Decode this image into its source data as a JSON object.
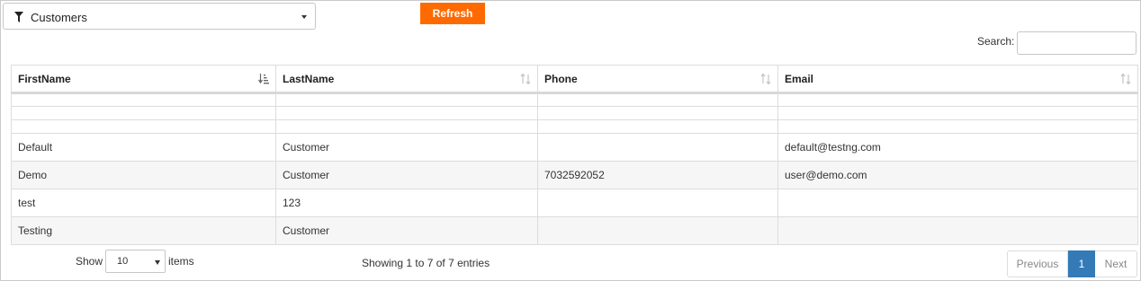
{
  "filter": {
    "label": "Customers",
    "icon": "filter-icon"
  },
  "toolbar": {
    "refresh_label": "Refresh"
  },
  "search": {
    "label": "Search:",
    "value": "",
    "placeholder": ""
  },
  "table": {
    "columns": [
      "FirstName",
      "LastName",
      "Phone",
      "Email"
    ],
    "sorted_column": "FirstName",
    "empty_rows": 3,
    "rows": [
      [
        "Default",
        "Customer",
        "",
        "default@testng.com"
      ],
      [
        "Demo",
        "Customer",
        "7032592052",
        "user@demo.com"
      ],
      [
        "test",
        "123",
        "",
        ""
      ],
      [
        "Testing",
        "Customer",
        "",
        ""
      ]
    ]
  },
  "footer": {
    "show_label": "Show",
    "page_size": "10",
    "items_label": "items",
    "info": "Showing 1 to 7 of 7 entries",
    "pager": {
      "previous": "Previous",
      "current": "1",
      "next": "Next"
    }
  },
  "colors": {
    "refresh": "#ff6a00",
    "active_page": "#337ab7"
  }
}
